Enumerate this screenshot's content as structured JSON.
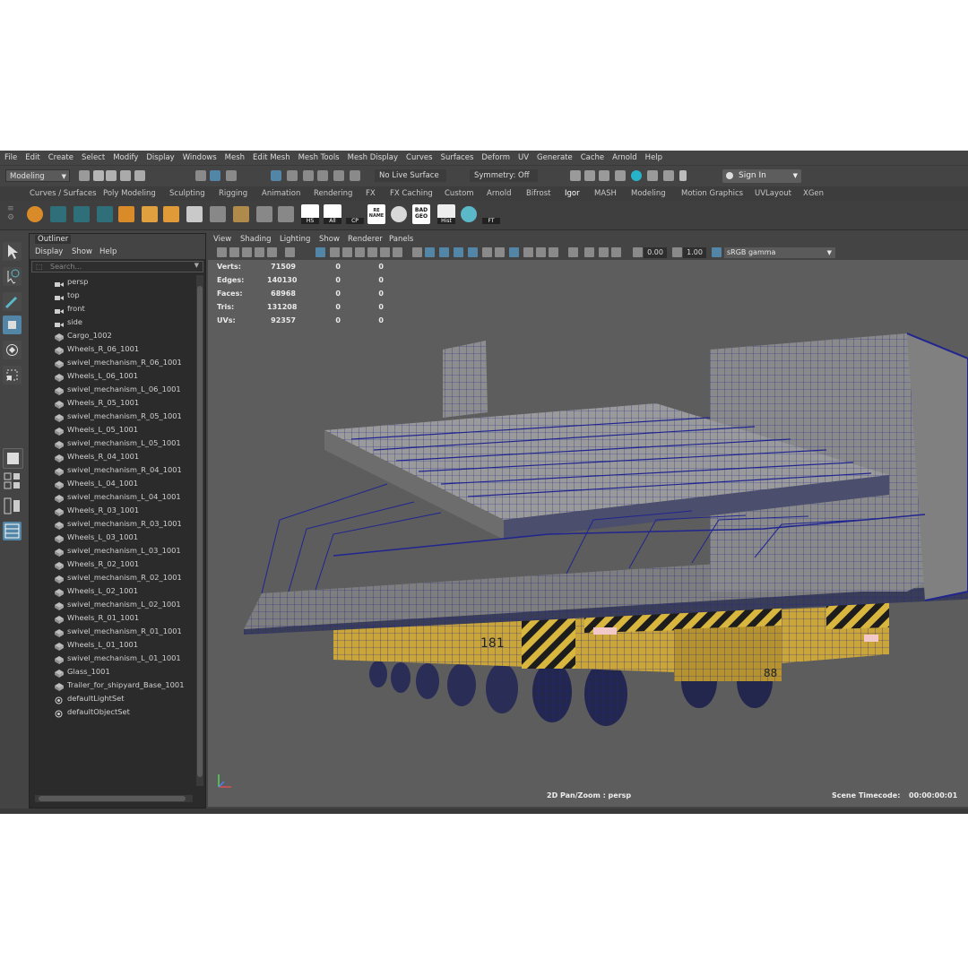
{
  "menubar": [
    "File",
    "Edit",
    "Create",
    "Select",
    "Modify",
    "Display",
    "Windows",
    "Mesh",
    "Edit Mesh",
    "Mesh Tools",
    "Mesh Display",
    "Curves",
    "Surfaces",
    "Deform",
    "UV",
    "Generate",
    "Cache",
    "Arnold",
    "Help"
  ],
  "statusline": {
    "mode": "Modeling",
    "live_surface": "No Live Surface",
    "symmetry": "Symmetry: Off",
    "sign_in": "Sign In"
  },
  "shelf_tabs": [
    "Curves / Surfaces",
    "Poly Modeling",
    "Sculpting",
    "Rigging",
    "Animation",
    "Rendering",
    "FX",
    "FX Caching",
    "Custom",
    "Arnold",
    "Bifrost",
    "Igor",
    "MASH",
    "Modeling",
    "Motion Graphics",
    "UVLayout",
    "XGen"
  ],
  "shelf_active_tab": "Igor",
  "shelf_labels": {
    "hs": "HS",
    "all": "All",
    "cp": "CP",
    "rename": "RE NAME",
    "badgeo": "BAD GEO",
    "hist": "Hist",
    "ft": "FT"
  },
  "outliner": {
    "title": "Outliner",
    "menu": [
      "Display",
      "Show",
      "Help"
    ],
    "search_placeholder": "Search...",
    "items": [
      {
        "label": "persp",
        "icon": "camera-icon"
      },
      {
        "label": "top",
        "icon": "camera-icon"
      },
      {
        "label": "front",
        "icon": "camera-icon"
      },
      {
        "label": "side",
        "icon": "camera-icon"
      },
      {
        "label": "Cargo_1002",
        "icon": "mesh-icon"
      },
      {
        "label": "Wheels_R_06_1001",
        "icon": "mesh-icon"
      },
      {
        "label": "swivel_mechanism_R_06_1001",
        "icon": "mesh-icon"
      },
      {
        "label": "Wheels_L_06_1001",
        "icon": "mesh-icon"
      },
      {
        "label": "swivel_mechanism_L_06_1001",
        "icon": "mesh-icon"
      },
      {
        "label": "Wheels_R_05_1001",
        "icon": "mesh-icon"
      },
      {
        "label": "swivel_mechanism_R_05_1001",
        "icon": "mesh-icon"
      },
      {
        "label": "Wheels_L_05_1001",
        "icon": "mesh-icon"
      },
      {
        "label": "swivel_mechanism_L_05_1001",
        "icon": "mesh-icon"
      },
      {
        "label": "Wheels_R_04_1001",
        "icon": "mesh-icon"
      },
      {
        "label": "swivel_mechanism_R_04_1001",
        "icon": "mesh-icon"
      },
      {
        "label": "Wheels_L_04_1001",
        "icon": "mesh-icon"
      },
      {
        "label": "swivel_mechanism_L_04_1001",
        "icon": "mesh-icon"
      },
      {
        "label": "Wheels_R_03_1001",
        "icon": "mesh-icon"
      },
      {
        "label": "swivel_mechanism_R_03_1001",
        "icon": "mesh-icon"
      },
      {
        "label": "Wheels_L_03_1001",
        "icon": "mesh-icon"
      },
      {
        "label": "swivel_mechanism_L_03_1001",
        "icon": "mesh-icon"
      },
      {
        "label": "Wheels_R_02_1001",
        "icon": "mesh-icon"
      },
      {
        "label": "swivel_mechanism_R_02_1001",
        "icon": "mesh-icon"
      },
      {
        "label": "Wheels_L_02_1001",
        "icon": "mesh-icon"
      },
      {
        "label": "swivel_mechanism_L_02_1001",
        "icon": "mesh-icon"
      },
      {
        "label": "Wheels_R_01_1001",
        "icon": "mesh-icon"
      },
      {
        "label": "swivel_mechanism_R_01_1001",
        "icon": "mesh-icon"
      },
      {
        "label": "Wheels_L_01_1001",
        "icon": "mesh-icon"
      },
      {
        "label": "swivel_mechanism_L_01_1001",
        "icon": "mesh-icon"
      },
      {
        "label": "Glass_1001",
        "icon": "mesh-icon"
      },
      {
        "label": "Trailer_for_shipyard_Base_1001",
        "icon": "mesh-icon"
      },
      {
        "label": "defaultLightSet",
        "icon": "set-icon"
      },
      {
        "label": "defaultObjectSet",
        "icon": "set-icon"
      }
    ]
  },
  "viewport": {
    "menu": [
      "View",
      "Shading",
      "Lighting",
      "Show",
      "Renderer",
      "Panels"
    ],
    "exposure": "0.00",
    "gamma_value": "1.00",
    "color_space": "sRGB gamma",
    "hud": [
      {
        "label": "Verts:",
        "v1": "71509",
        "v2": "0",
        "v3": "0"
      },
      {
        "label": "Edges:",
        "v1": "140130",
        "v2": "0",
        "v3": "0"
      },
      {
        "label": "Faces:",
        "v1": "68968",
        "v2": "0",
        "v3": "0"
      },
      {
        "label": "Tris:",
        "v1": "131208",
        "v2": "0",
        "v3": "0"
      },
      {
        "label": "UVs:",
        "v1": "92357",
        "v2": "0",
        "v3": "0"
      }
    ],
    "camera_label": "2D Pan/Zoom : persp",
    "timecode_label": "Scene Timecode:",
    "timecode_value": "00:00:00:01",
    "model_numbers": [
      "181",
      "88"
    ]
  },
  "colors": {
    "maya_accent": "#27b3c8",
    "selected_tool": "#5285a6",
    "wireframe": "#1a1e8c",
    "trailer_yellow": "#c9a53a"
  }
}
